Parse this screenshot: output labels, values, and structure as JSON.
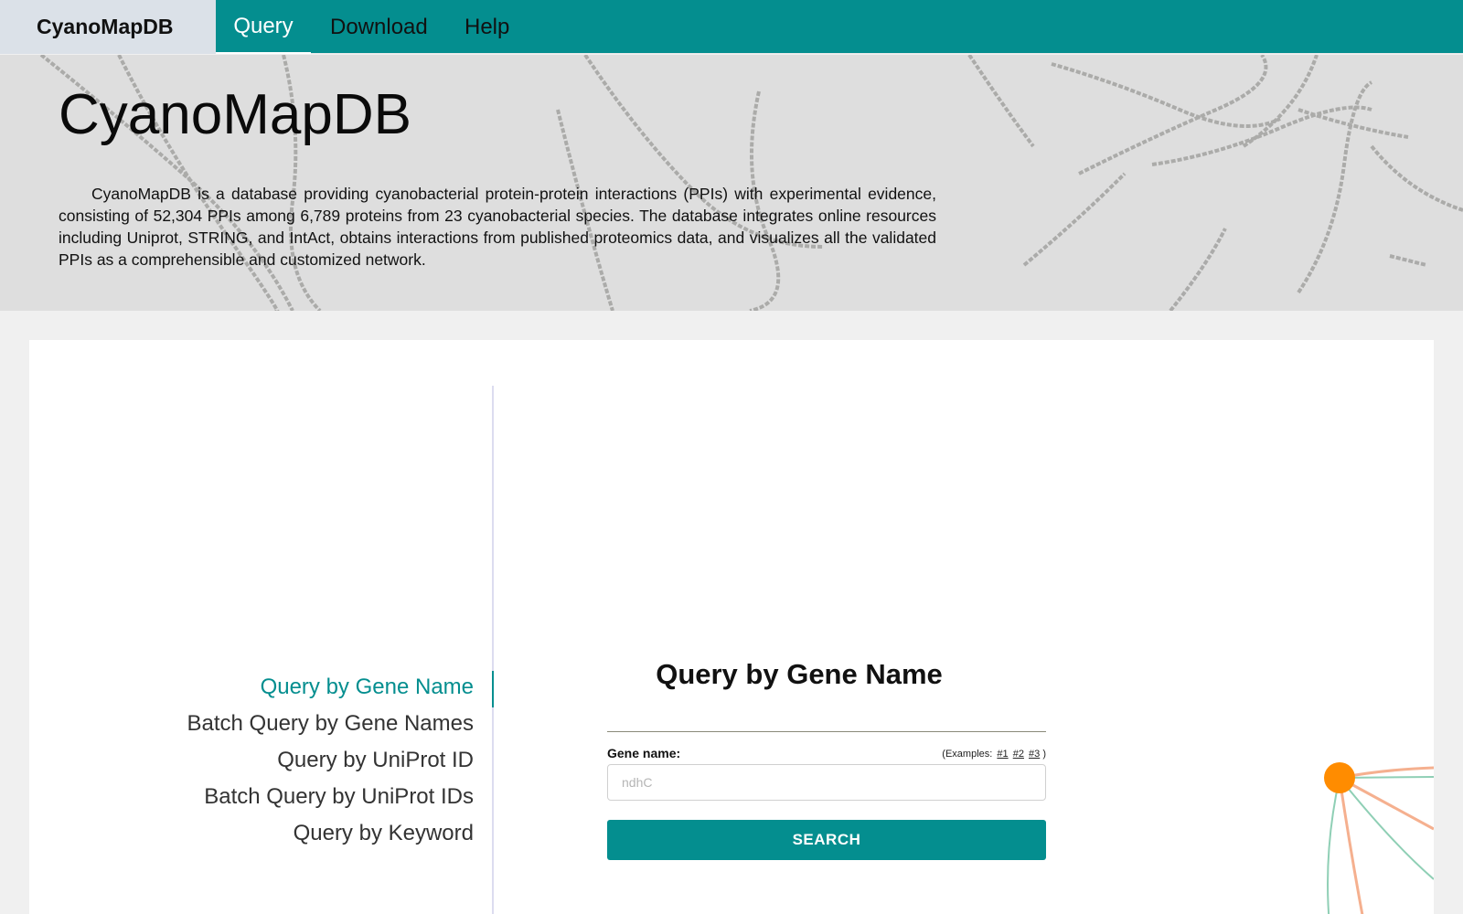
{
  "nav": {
    "brand": "CyanoMapDB",
    "items": [
      {
        "label": "Query",
        "active": true
      },
      {
        "label": "Download",
        "active": false
      },
      {
        "label": "Help",
        "active": false
      }
    ]
  },
  "hero": {
    "title": "CyanoMapDB",
    "description": "CyanoMapDB is a database providing cyanobacterial protein-protein interactions (PPIs) with experimental evidence, consisting of 52,304 PPIs among 6,789 proteins from 23 cyanobacterial species. The database integrates online resources including Uniprot, STRING, and IntAct, obtains interactions from published proteomics data, and visualizes all the validated PPIs as a comprehensible and customized network."
  },
  "sidebar": {
    "items": [
      {
        "label": "Query by Gene Name",
        "active": true
      },
      {
        "label": "Batch Query by Gene Names",
        "active": false
      },
      {
        "label": "Query by UniProt ID",
        "active": false
      },
      {
        "label": "Batch Query by UniProt IDs",
        "active": false
      },
      {
        "label": "Query by Keyword",
        "active": false
      }
    ]
  },
  "form": {
    "title": "Query by Gene Name",
    "field_label": "Gene name:",
    "examples_prefix": "(Examples:",
    "examples": [
      "#1",
      "#2",
      "#3"
    ],
    "examples_suffix": ")",
    "input_value": "",
    "input_placeholder": "ndhC",
    "search_label": "SEARCH"
  },
  "colors": {
    "accent": "#048e8f",
    "brand_bg": "#dbe1e8",
    "node_orange": "#ff8c00",
    "edge_salmon": "#f5b08f",
    "edge_green": "#8fcfb5"
  }
}
